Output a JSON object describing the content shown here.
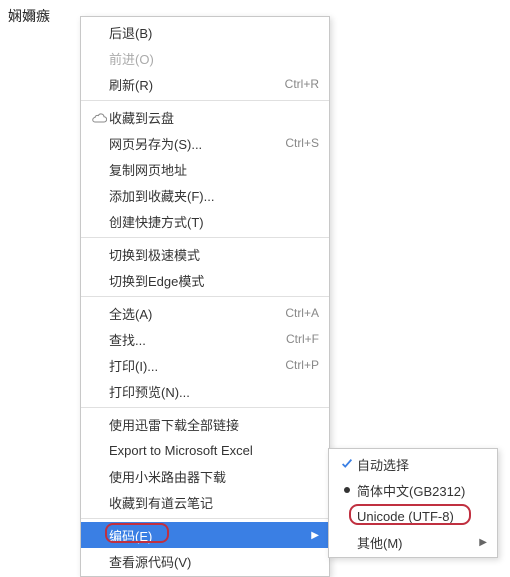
{
  "garbled_text": "娴嬭瘯",
  "menu": {
    "groups": [
      [
        {
          "id": "back",
          "label": "后退(B)",
          "shortcut": "",
          "disabled": false
        },
        {
          "id": "forward",
          "label": "前进(O)",
          "shortcut": "",
          "disabled": true
        },
        {
          "id": "refresh",
          "label": "刷新(R)",
          "shortcut": "Ctrl+R",
          "disabled": false
        }
      ],
      [
        {
          "id": "save-cloud",
          "label": "收藏到云盘",
          "icon": "cloud-icon"
        },
        {
          "id": "save-as",
          "label": "网页另存为(S)...",
          "shortcut": "Ctrl+S"
        },
        {
          "id": "copy-url",
          "label": "复制网页地址"
        },
        {
          "id": "add-fav",
          "label": "添加到收藏夹(F)..."
        },
        {
          "id": "shortcut",
          "label": "创建快捷方式(T)"
        }
      ],
      [
        {
          "id": "speed-mode",
          "label": "切换到极速模式"
        },
        {
          "id": "edge-mode",
          "label": "切换到Edge模式"
        }
      ],
      [
        {
          "id": "select-all",
          "label": "全选(A)",
          "shortcut": "Ctrl+A"
        },
        {
          "id": "find",
          "label": "查找...",
          "shortcut": "Ctrl+F"
        },
        {
          "id": "print",
          "label": "打印(I)...",
          "shortcut": "Ctrl+P"
        },
        {
          "id": "print-preview",
          "label": "打印预览(N)..."
        }
      ],
      [
        {
          "id": "xunlei",
          "label": "使用迅雷下载全部链接"
        },
        {
          "id": "export-excel",
          "label": "Export to Microsoft Excel"
        },
        {
          "id": "xiaomi",
          "label": "使用小米路由器下载"
        },
        {
          "id": "youdao",
          "label": "收藏到有道云笔记"
        }
      ],
      [
        {
          "id": "encoding",
          "label": "编码(E)",
          "submenu": true,
          "hovered": true
        },
        {
          "id": "view-source",
          "label": "查看源代码(V)"
        }
      ]
    ]
  },
  "submenu": {
    "items": [
      {
        "id": "auto",
        "label": "自动选择",
        "check": true
      },
      {
        "id": "gb2312",
        "label": "简体中文(GB2312)",
        "bullet": true
      },
      {
        "id": "utf8",
        "label": "Unicode (UTF-8)"
      },
      {
        "id": "other",
        "label": "其他(M)",
        "submenu": true
      }
    ]
  }
}
